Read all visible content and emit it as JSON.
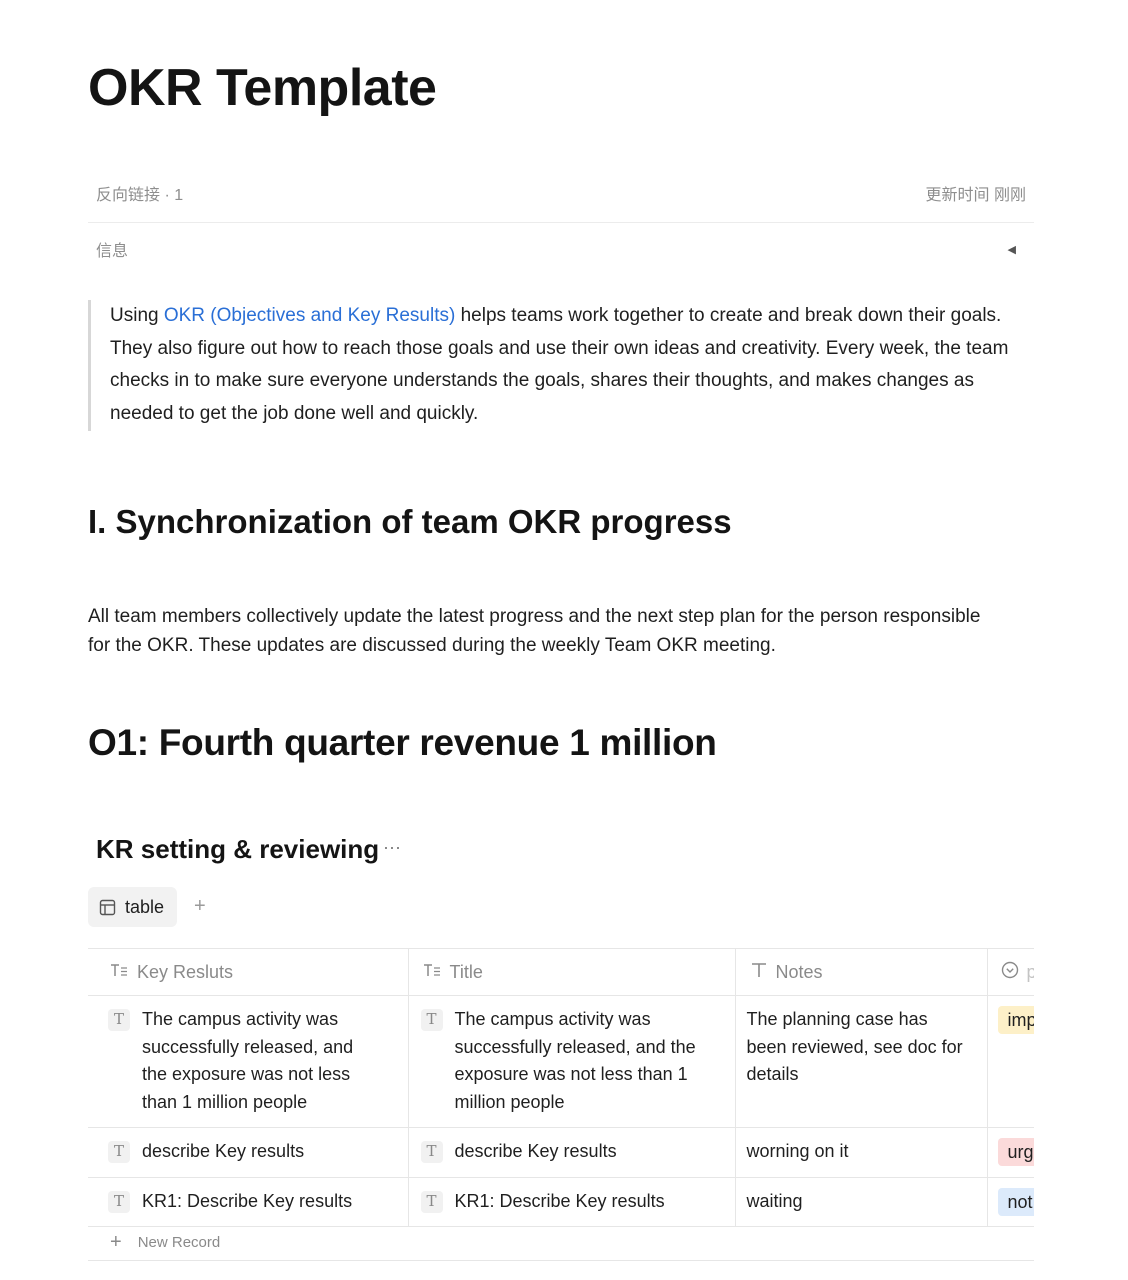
{
  "page": {
    "title": "OKR Template",
    "backlinks": "反向链接 · 1",
    "updated": "更新时间 刚刚",
    "info_label": "信息",
    "info_toggle": "◀"
  },
  "intro": {
    "before": "Using ",
    "link": "OKR (Objectives and Key Results)",
    "after": " helps teams work together to create and break down their goals. They also figure out how to reach those goals and use their own ideas and creativity. Every week, the team checks in to make sure everyone understands the goals, shares their thoughts, and makes changes as needed to get the job done well and quickly."
  },
  "section1": {
    "heading": "I. Synchronization of team OKR progress",
    "text": "All team members collectively update the latest progress and the next step plan for the person responsible for the OKR. These updates are discussed during the weekly Team OKR meeting."
  },
  "objective": {
    "heading": "O1: Fourth quarter revenue 1 million"
  },
  "database": {
    "title": "KR setting & reviewing",
    "more": "···",
    "view_tab": "table",
    "add_view": "+",
    "columns": {
      "key_results": "Key Resluts",
      "title": "Title",
      "notes": "Notes",
      "priority": "p"
    },
    "rows": [
      {
        "key_result": "The campus activity was successfully released, and the exposure was not less than 1 million people",
        "title": "The campus activity was successfully released, and the exposure was not less than 1 million people",
        "notes": "The planning case has been reviewed, see doc for details",
        "tag": "imp",
        "tag_bg": "#fdf0c8"
      },
      {
        "key_result": "describe Key results",
        "title": "describe Key results",
        "notes": "worning on it",
        "tag": "urg",
        "tag_bg": "#fbdada"
      },
      {
        "key_result": "KR1: Describe Key results",
        "title": "KR1: Describe Key results",
        "notes": "waiting",
        "tag": "not",
        "tag_bg": "#dceafb"
      }
    ],
    "new_record": "New Record",
    "row_icon": "T"
  },
  "colors": {
    "link": "#2a6fd6",
    "muted": "#8e8e8e"
  }
}
